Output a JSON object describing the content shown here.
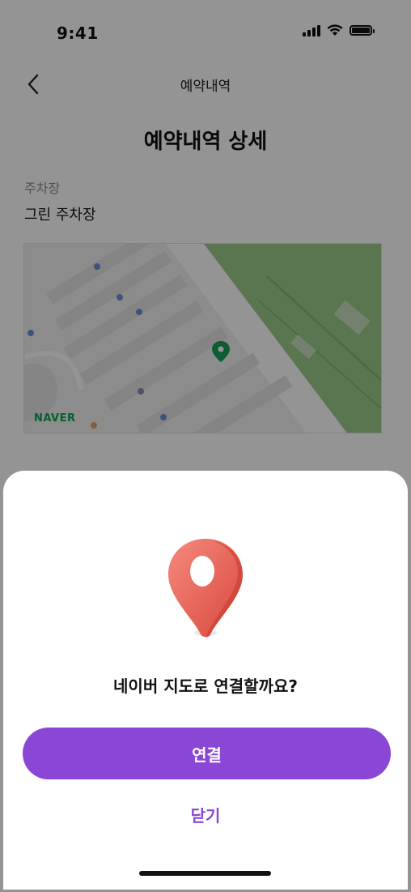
{
  "status_bar": {
    "time": "9:41",
    "icons": [
      "signal-icon",
      "wifi-icon",
      "battery-icon"
    ]
  },
  "header": {
    "back_icon": "chevron-left-icon",
    "title": "예약내역"
  },
  "page_title": "예약내역 상세",
  "parking": {
    "label": "주차장",
    "value": "그린 주차장"
  },
  "map": {
    "provider_logo": "NAVER",
    "marker_icon": "map-marker-icon",
    "park_color": "#9ccb8a",
    "marker_color": "#1a9e5a"
  },
  "sheet": {
    "icon": "location-pin-icon",
    "question": "네이버 지도로 연결할까요?",
    "connect_label": "연결",
    "close_label": "닫기"
  },
  "colors": {
    "accent": "#8a47d6",
    "pin": "#ef6a5e",
    "overlay": "rgba(0,0,0,0.42)"
  }
}
